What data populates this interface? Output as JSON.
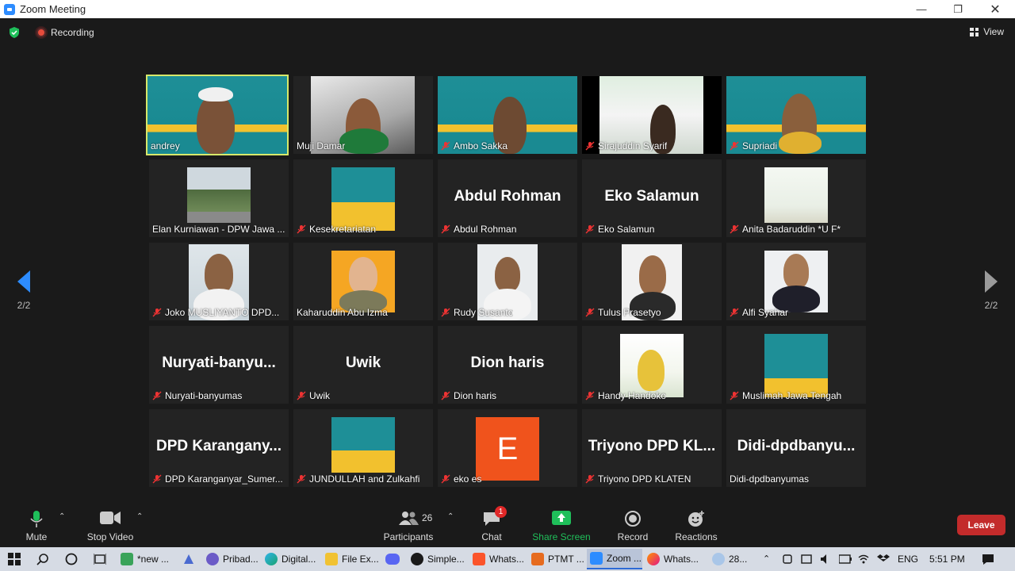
{
  "window": {
    "title": "Zoom Meeting"
  },
  "top_bar": {
    "recording_label": "Recording",
    "view_label": "View"
  },
  "navigation": {
    "prev_page": "2/2",
    "next_page": "2/2"
  },
  "participants_grid": [
    {
      "name": "andrey",
      "display": "video",
      "muted": false,
      "active": true
    },
    {
      "name": "Muji Damar",
      "display": "video",
      "muted": false
    },
    {
      "name": "Ambo Sakka",
      "display": "video",
      "muted": true
    },
    {
      "name": "Sirajuddin Syarif",
      "display": "video",
      "muted": true
    },
    {
      "name": "Supriadi",
      "display": "video",
      "muted": true
    },
    {
      "name": "Elan Kurniawan - DPW Jawa ...",
      "display": "image",
      "muted": false
    },
    {
      "name": "Kesekretariatan",
      "display": "image",
      "muted": true
    },
    {
      "name": "Abdul Rohman",
      "display": "text",
      "big_label": "Abdul Rohman",
      "muted": true
    },
    {
      "name": "Eko Salamun",
      "display": "text",
      "big_label": "Eko Salamun",
      "muted": true
    },
    {
      "name": "Anita Badaruddin *U F*",
      "display": "image",
      "muted": true
    },
    {
      "name": "Joko MUSLIYANTO    DPD...",
      "display": "image",
      "muted": true
    },
    {
      "name": "Kaharuddin Abu Izma",
      "display": "image",
      "muted": false
    },
    {
      "name": "Rudy Susanto",
      "display": "image",
      "muted": true
    },
    {
      "name": "Tulus Prasetyo",
      "display": "image",
      "muted": true
    },
    {
      "name": "Alfi Syahar",
      "display": "image",
      "muted": true
    },
    {
      "name": "Nuryati-banyumas",
      "display": "text",
      "big_label": "Nuryati-banyu...",
      "muted": true
    },
    {
      "name": "Uwik",
      "display": "text",
      "big_label": "Uwik",
      "muted": true
    },
    {
      "name": "Dion haris",
      "display": "text",
      "big_label": "Dion haris",
      "muted": true
    },
    {
      "name": "Handy Handoko",
      "display": "image",
      "muted": true
    },
    {
      "name": "Muslimah Jawa Tengah",
      "display": "image",
      "muted": true
    },
    {
      "name": "DPD Karanganyar_Sumer...",
      "display": "text",
      "big_label": "DPD  Karangany...",
      "muted": true
    },
    {
      "name": "JUNDULLAH and Zulkahfi",
      "display": "image",
      "muted": true
    },
    {
      "name": "eko es",
      "display": "avatar",
      "avatar_letter": "E",
      "muted": true
    },
    {
      "name": "Triyono DPD KLATEN",
      "display": "text",
      "big_label": "Triyono  DPD  KL...",
      "muted": true
    },
    {
      "name": "Didi-dpdbanyumas",
      "display": "text",
      "big_label": "Didi-dpdbanyu...",
      "muted": false
    }
  ],
  "toolbar": {
    "mute_label": "Mute",
    "video_label": "Stop Video",
    "participants_label": "Participants",
    "participants_count": "26",
    "chat_label": "Chat",
    "chat_badge": "1",
    "share_label": "Share Screen",
    "record_label": "Record",
    "reactions_label": "Reactions",
    "leave_label": "Leave"
  },
  "taskbar": {
    "items": [
      "*new ...",
      "Pribad...",
      "Digital...",
      "File Ex...",
      "Simple...",
      "Whats...",
      "PTMT ...",
      "Zoom ...",
      "Whats..."
    ],
    "weather": "28...",
    "language": "ENG",
    "time": "5:51 PM"
  },
  "colors": {
    "accent_green": "#1fbf5a",
    "leave_red": "#c32b2b",
    "zoom_blue": "#2d8cff",
    "active_border": "#d7e86a"
  }
}
